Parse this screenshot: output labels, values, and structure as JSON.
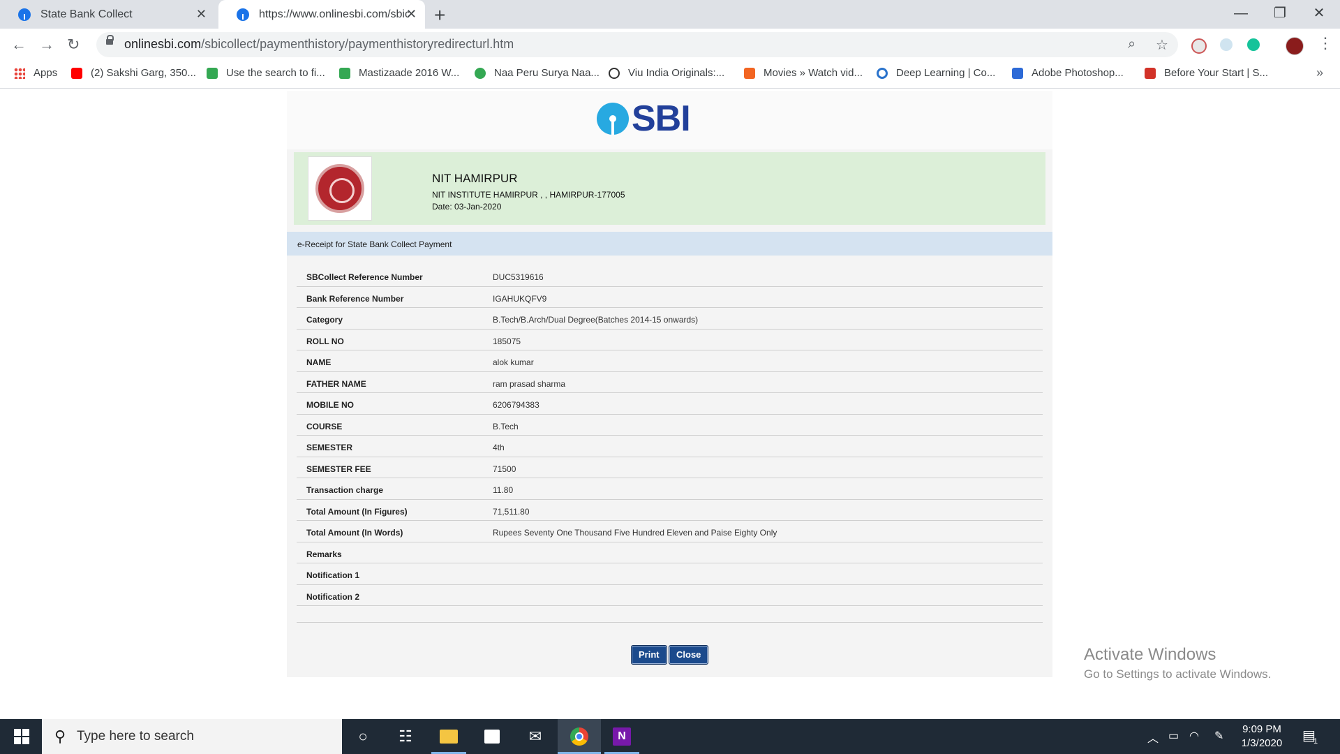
{
  "browser": {
    "tabs": [
      {
        "title": "State Bank Collect",
        "active": false
      },
      {
        "title": "https://www.onlinesbi.com/sbicollect/paymenthistory/paymenthistoryredirecturl.htm",
        "active": true
      }
    ],
    "new_tab": "+",
    "window_controls": {
      "minimize": "—",
      "restore": "❐",
      "close": "✕"
    },
    "url_host": "onlinesbi.com",
    "url_path": "/sbicollect/paymenthistory/paymenthistoryredirecturl.htm",
    "bookmarks": [
      {
        "label": "Apps",
        "icon": "apps-grid-icon",
        "color": "#ea4335"
      },
      {
        "label": "(2) Sakshi Garg, 350...",
        "icon": "youtube-icon",
        "color": "#ff0000"
      },
      {
        "label": "Use the search to fi...",
        "icon": "form-icon",
        "color": "#34a853"
      },
      {
        "label": "Mastizaade 2016 W...",
        "icon": "form-icon",
        "color": "#34a853"
      },
      {
        "label": "Naa Peru Surya Naa...",
        "icon": "play-icon",
        "color": "#34a853"
      },
      {
        "label": "Viu India Originals:...",
        "icon": "viu-icon",
        "color": "#333333"
      },
      {
        "label": "Movies » Watch vid...",
        "icon": "movies-icon",
        "color": "#f26522"
      },
      {
        "label": "Deep Learning | Co...",
        "icon": "coursera-icon",
        "color": "#2a73cc"
      },
      {
        "label": "Adobe Photoshop...",
        "icon": "photoshop-icon",
        "color": "#2d6ad7"
      },
      {
        "label": "Before Your Start | S...",
        "icon": "edx-icon",
        "color": "#d23228"
      }
    ],
    "bookmarks_more": "»"
  },
  "page": {
    "brand": "SBI",
    "institution": {
      "name": "NIT HAMIRPUR",
      "address": "NIT INSTITUTE HAMIRPUR , , HAMIRPUR-177005",
      "date": "Date: 03-Jan-2020"
    },
    "receipt_title": "e-Receipt for State Bank Collect Payment",
    "details": [
      {
        "label": "SBCollect Reference Number",
        "value": "DUC5319616"
      },
      {
        "label": "Bank Reference Number",
        "value": "IGAHUKQFV9"
      },
      {
        "label": "Category",
        "value": "B.Tech/B.Arch/Dual Degree(Batches 2014-15 onwards)"
      },
      {
        "label": "ROLL NO",
        "value": "185075"
      },
      {
        "label": "NAME",
        "value": "alok kumar"
      },
      {
        "label": "FATHER NAME",
        "value": "ram prasad sharma"
      },
      {
        "label": "MOBILE NO",
        "value": "6206794383"
      },
      {
        "label": "COURSE",
        "value": "B.Tech"
      },
      {
        "label": "SEMESTER",
        "value": "4th"
      },
      {
        "label": "SEMESTER FEE",
        "value": "71500"
      },
      {
        "label": "Transaction charge",
        "value": "11.80"
      },
      {
        "label": "Total Amount (In Figures)",
        "value": "71,511.80"
      },
      {
        "label": "Total Amount (In Words)",
        "value": "Rupees Seventy One Thousand Five Hundred Eleven and Paise Eighty Only"
      },
      {
        "label": "Remarks",
        "value": ""
      },
      {
        "label": "Notification 1",
        "value": ""
      },
      {
        "label": "Notification 2",
        "value": ""
      }
    ],
    "buttons": {
      "print": "Print",
      "close": "Close"
    }
  },
  "watermark": {
    "line1": "Activate Windows",
    "line2": "Go to Settings to activate Windows."
  },
  "taskbar": {
    "search_placeholder": "Type here to search",
    "time": "9:09 PM",
    "date": "1/3/2020",
    "notification_count": "1"
  },
  "colors": {
    "sbi_blue": "#22409a",
    "sbi_cyan": "#27a9e1",
    "institution_bg": "#dcefd8",
    "receipt_header_bg": "#d5e3f1",
    "button_bg": "#1b4a8c"
  }
}
